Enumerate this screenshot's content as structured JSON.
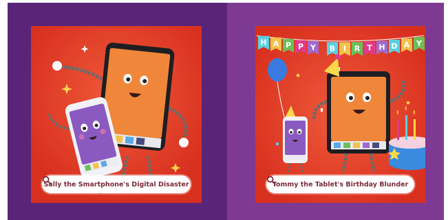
{
  "cards": [
    {
      "title": "Sally the Smartphone's Digital Disaster",
      "icon": "search-icon"
    },
    {
      "title": "Tommy the Tablet's Birthday Blunder",
      "icon": "search-icon"
    }
  ],
  "banner": {
    "letters": [
      "H",
      "A",
      "P",
      "P",
      "Y",
      "B",
      "I",
      "R",
      "T",
      "H",
      "D",
      "A",
      "Y"
    ]
  },
  "colors": {
    "left_bg": "#5a2578",
    "right_bg": "#7e3a93",
    "card_bg": "#e23a2a",
    "pill_text": "#7a2a3a"
  }
}
